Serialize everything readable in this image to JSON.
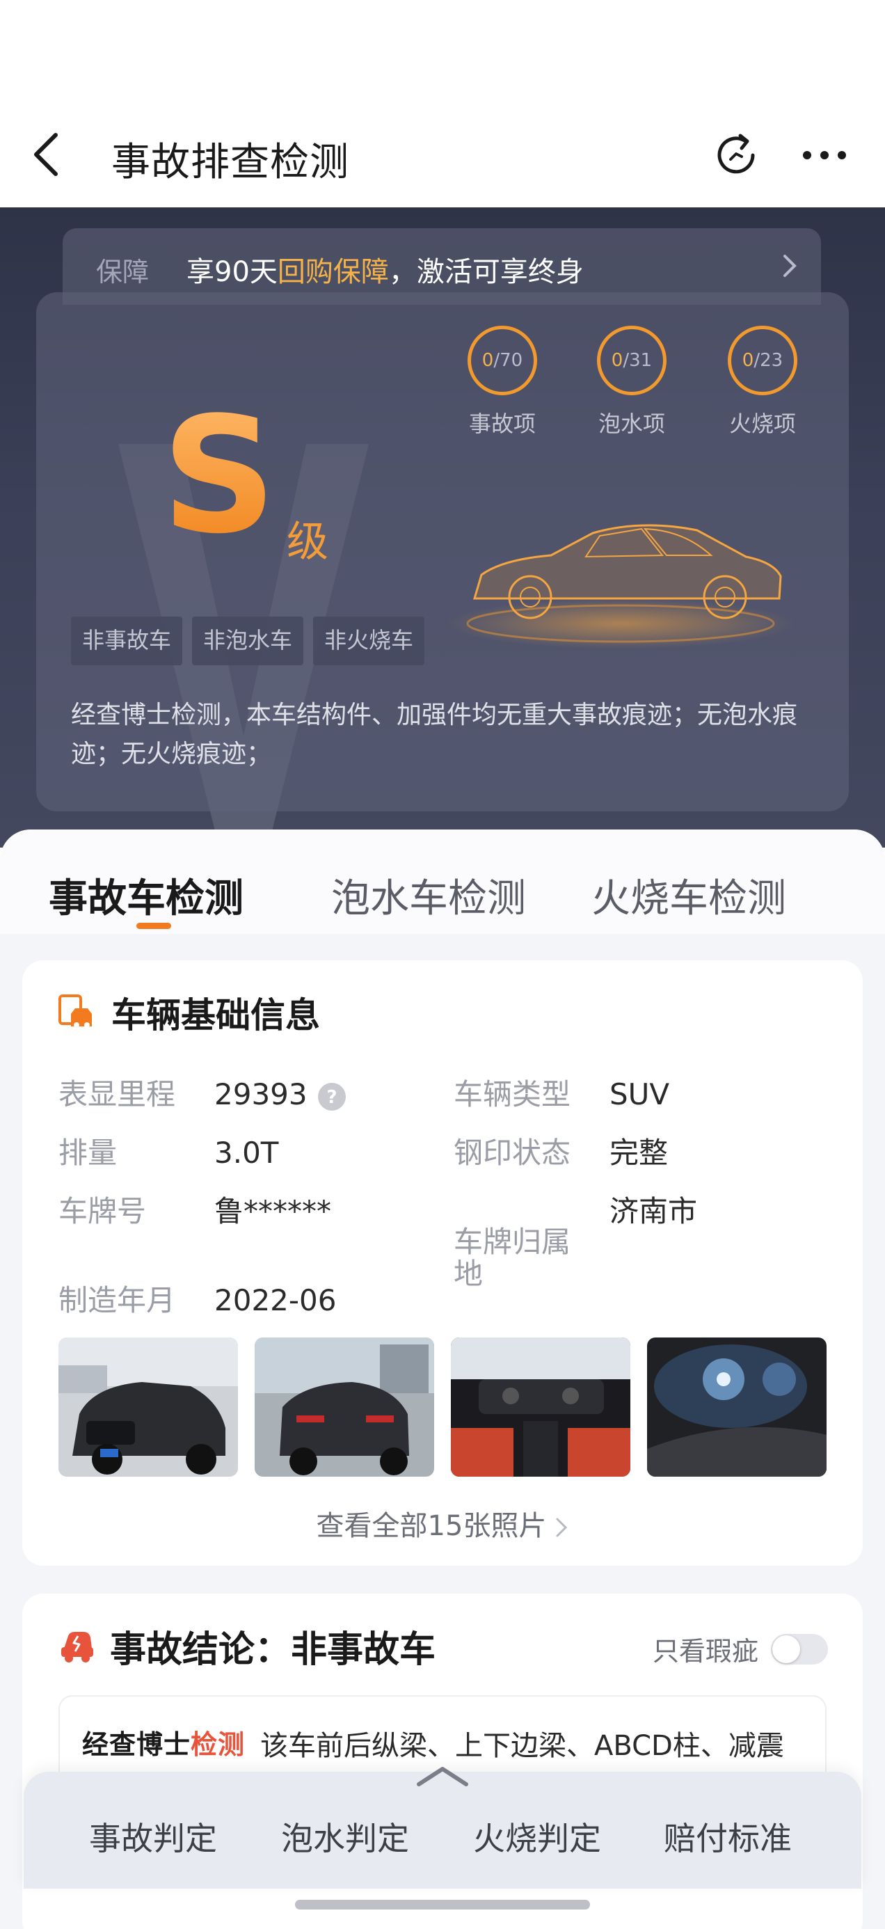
{
  "nav": {
    "title": "事故排查检测"
  },
  "guarantee": {
    "label": "保障",
    "text_prefix": "享90天",
    "text_highlight": "回购保障",
    "text_suffix": "，激活可享终身"
  },
  "grade": {
    "letter": "S",
    "suffix": "级",
    "checks": [
      {
        "label": "事故项",
        "found": "0",
        "total": "/70"
      },
      {
        "label": "泡水项",
        "found": "0",
        "total": "/31"
      },
      {
        "label": "火烧项",
        "found": "0",
        "total": "/23"
      }
    ],
    "tags": [
      "非事故车",
      "非泡水车",
      "非火烧车"
    ],
    "description": "经查博士检测，本车结构件、加强件均无重大事故痕迹；无泡水痕迹；无火烧痕迹；"
  },
  "tabs": [
    "事故车检测",
    "泡水车检测",
    "火烧车检测"
  ],
  "vehicle_info": {
    "title": "车辆基础信息",
    "rows": [
      {
        "key": "表显里程",
        "value": "29393"
      },
      {
        "key": "车辆类型",
        "value": "SUV"
      },
      {
        "key": "排量",
        "value": "3.0T"
      },
      {
        "key": "钢印状态",
        "value": "完整"
      },
      {
        "key": "车牌号",
        "value": "鲁******"
      },
      {
        "key": "车牌归属\n地",
        "value": "济南市"
      },
      {
        "key": "制造年月",
        "value": "2022-06"
      }
    ],
    "view_all": "查看全部15张照片"
  },
  "conclusion": {
    "title": "事故结论：非事故车",
    "only_flaw_label": "只看瑕疵",
    "only_flaw_on": false,
    "report_logo_a": "经查博士",
    "report_logo_b": "检测",
    "report_text": "该车前后纵梁、上下边梁、ABCD柱、减震"
  },
  "bottom_bar": [
    "事故判定",
    "泡水判定",
    "火烧判定",
    "赔付标准"
  ],
  "colors": {
    "accent": "#f27a1f",
    "gold": "#f5b24a",
    "hero_bg": "#3b3f57"
  }
}
